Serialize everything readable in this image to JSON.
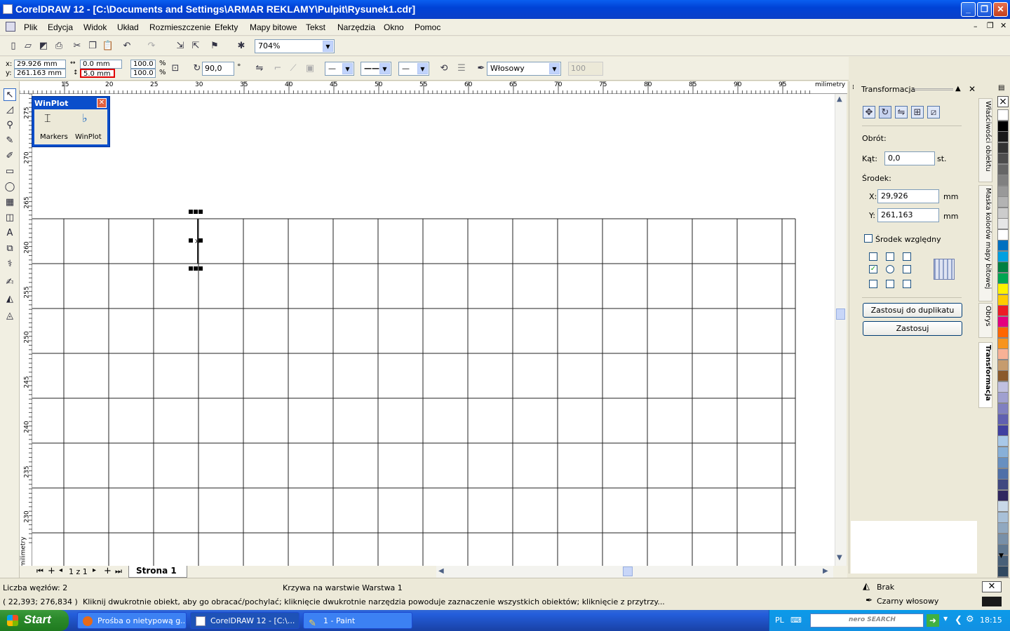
{
  "window": {
    "title": "CorelDRAW 12 - [C:\\Documents and Settings\\ARMAR REKLAMY\\Pulpit\\Rysunek1.cdr]"
  },
  "menu": [
    "Plik",
    "Edycja",
    "Widok",
    "Układ",
    "Rozmieszczenie",
    "Efekty",
    "Mapy bitowe",
    "Tekst",
    "Narzędzia",
    "Okno",
    "Pomoc"
  ],
  "toolbar": {
    "zoom": "704%"
  },
  "propbar": {
    "x": "29.926 mm",
    "y": "261.163 mm",
    "w": "0.0 mm",
    "h": "5.0 mm",
    "sx": "100.0",
    "sy": "100.0",
    "pct": "%",
    "angle": "90,0",
    "deg": "°",
    "outline_width": "Włosowy",
    "dim": "100"
  },
  "ruler": {
    "h_labels": [
      "15",
      "20",
      "25",
      "30",
      "35",
      "40",
      "45",
      "50",
      "55",
      "60",
      "65",
      "70",
      "75",
      "80",
      "85",
      "90",
      "95"
    ],
    "h_unit": "milimetry",
    "v_labels": [
      "275",
      "270",
      "265",
      "260",
      "255",
      "250",
      "245",
      "240",
      "235",
      "230"
    ],
    "v_unit": "milimetry"
  },
  "winplot": {
    "title": "WinPlot",
    "items": [
      "Markers",
      "WinPlot"
    ]
  },
  "pages": {
    "counter": "1 z 1",
    "tab": "Strona 1"
  },
  "docker": {
    "title": "Transformacja",
    "rotation_label": "Obrót:",
    "angle_label": "Kąt:",
    "angle_value": "0,0",
    "angle_unit": "st.",
    "center_label": "Środek:",
    "x_label": "X:",
    "x_value": "29,926",
    "x_unit": "mm",
    "y_label": "Y:",
    "y_value": "261,163",
    "y_unit": "mm",
    "relative_center": "Środek względny",
    "apply_duplicate": "Zastosuj do duplikatu",
    "apply": "Zastosuj"
  },
  "side_tabs": [
    "Właściwości obiektu",
    "Maska kolorów mapy bitowej",
    "Obrys",
    "Transformacja"
  ],
  "palette": [
    "#ffffff",
    "#000000",
    "#1a1a1a",
    "#333333",
    "#4d4d4d",
    "#666666",
    "#808080",
    "#999999",
    "#b3b3b3",
    "#cccccc",
    "#e6e6e6",
    "#ffffff",
    "#0070c0",
    "#00a0e0",
    "#008040",
    "#00a651",
    "#fff200",
    "#ffcc00",
    "#ed1c24",
    "#e4007f",
    "#ff6600",
    "#f7941d",
    "#f8b195",
    "#c69c6d",
    "#8b5a2b",
    "#c0c0e0",
    "#a0a0d0",
    "#8080c0",
    "#6060b0",
    "#4040a0",
    "#a8c8e8",
    "#88b0d8",
    "#6890c0",
    "#5070a8",
    "#404880",
    "#302860",
    "#c8d8e8",
    "#a8c0d8",
    "#90a8c0",
    "#7890a8",
    "#607890",
    "#486078",
    "#304860",
    "#203040"
  ],
  "status": {
    "nodes": "Liczba węzłów: 2",
    "layer": "Krzywa na warstwie Warstwa 1",
    "coords": "( 22,393; 276,834 )",
    "hint": "Kliknij dwukrotnie obiekt, aby go obracać/pochylać; kliknięcie dwukrotnie narzędzia powoduje zaznaczenie wszystkich obiektów; kliknięcie z przytrzy...",
    "fill": "Brak",
    "outline": "Czarny włosowy"
  },
  "taskbar": {
    "start": "Start",
    "tasks": [
      "Prośba o nietypową g...",
      "CorelDRAW 12 - [C:\\...",
      "1 - Paint"
    ],
    "lang": "PL",
    "search_brand": "nero SEARCH",
    "clock": "18:15"
  }
}
